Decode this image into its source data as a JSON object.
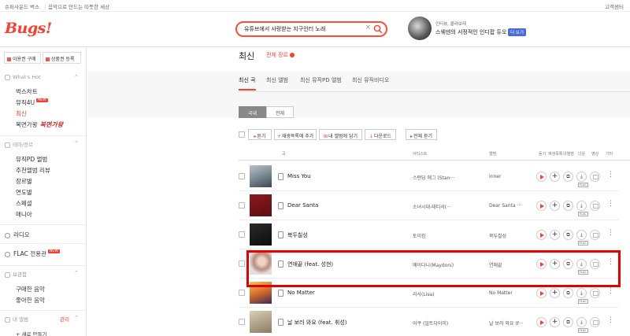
{
  "topbar": {
    "link1": "슈퍼사운드 벅스",
    "link2": "음악으로 만드는 따뜻한 세상",
    "cs": "고객센터"
  },
  "header": {
    "logo": "Bugs!",
    "search_value": "유튜브에서 사랑받는 지구인터 노래",
    "promo_sub": "인터뷰, 콜라보레",
    "promo_title": "스웨덴의 서정적인 인디팝 듀오",
    "promo_badge": "더 보기"
  },
  "sidebar": {
    "btn_buy": "이용권 구매",
    "btn_register": "상품권 등록",
    "section_whatshot": "What's Hot",
    "items_hot": [
      "벅스차트",
      "뮤직4U",
      "최신",
      "복면가왕"
    ],
    "new_badge": "NEW",
    "bokmyeon_logo": "복면가왕",
    "section_theme": "테마/장르",
    "items_theme": [
      "뮤직PD 앨범",
      "추천앨범 리뷰",
      "장르별",
      "연도별",
      "스페셜",
      "매니아"
    ],
    "radio": "라디오",
    "flac": "FLAC 전용관",
    "section_my": "보관함",
    "items_my": [
      "구매한 음악",
      "좋아한 음악"
    ],
    "section_album": "내 앨범",
    "edit": "관리",
    "new_album": "+ 새로 만들기"
  },
  "main": {
    "page_title": "최신",
    "genre": "전체 장르",
    "tabs": [
      "최신 곡",
      "최신 앨범",
      "최신 뮤직PD 앨범",
      "최신 뮤직비디오"
    ],
    "toggle_domestic": "국내",
    "toggle_all": "전체",
    "actions": {
      "listen": "듣기",
      "add_playlist": "재생목록에 추가",
      "add_album": "내 앨범에 담기",
      "download": "다운로드",
      "listen_all": "전체 듣기"
    },
    "headers": {
      "song": "곡",
      "artist": "아티스트",
      "album": "앨범",
      "listen": "듣기",
      "playlist": "재생목록",
      "myalbum": "내앨범",
      "download": "다운",
      "video": "영상",
      "etc": "기타"
    },
    "flac_tag": "FLAC",
    "rows": [
      {
        "title": "Miss You",
        "artist": "스탠딩 에그 (Stan···",
        "album": "inner"
      },
      {
        "title": "Dear Santa",
        "artist": "소녀시대-태티서(···",
        "album": "Dear Santa ···"
      },
      {
        "title": "북두칠성",
        "artist": "토이킴",
        "album": "북두칠성"
      },
      {
        "title": "연애끝 (feat. 성현)",
        "artist": "메이다니(Maydoni)",
        "album": "연애끝"
      },
      {
        "title": "No Matter",
        "artist": "리사(Lisa)",
        "album": "No Matter"
      },
      {
        "title": "날 보러 와요 (feat. 휘성)",
        "artist": "어쿠 (얼트다이미)",
        "album": "날 보러 와요 (f···"
      }
    ]
  },
  "colors": {
    "accent": "#ff3d2e",
    "highlight": "#e60000"
  }
}
